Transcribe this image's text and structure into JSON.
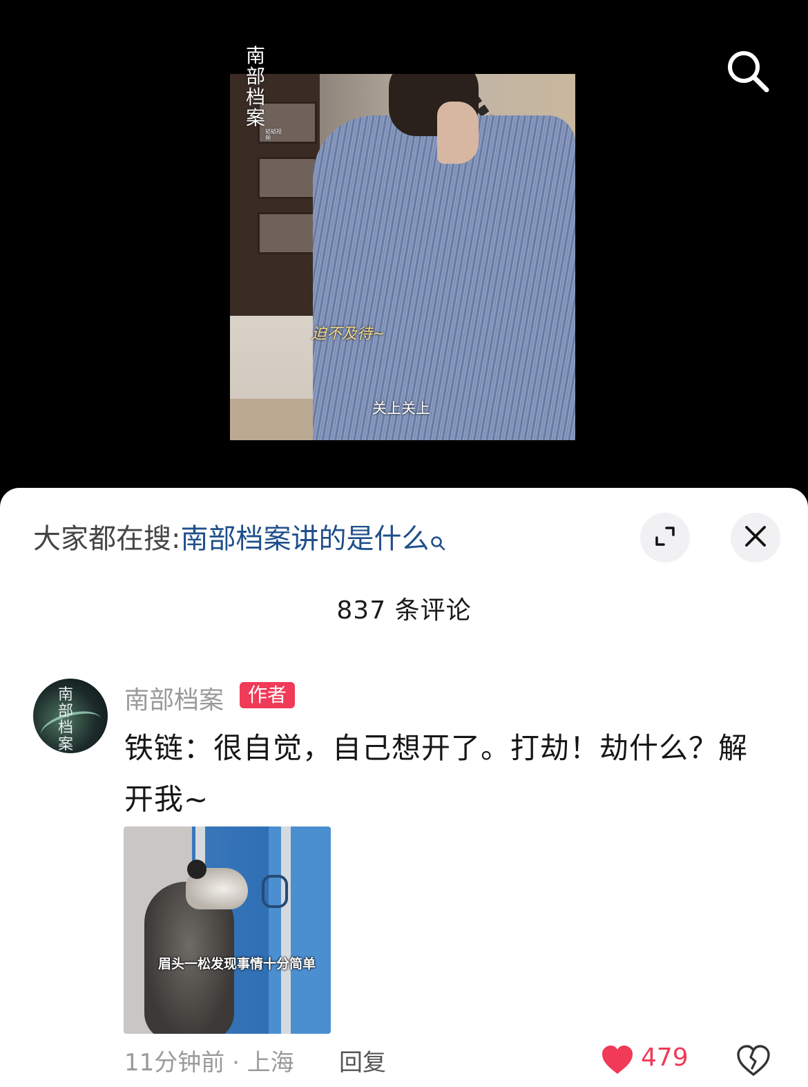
{
  "video": {
    "show_logo": "南部档案",
    "show_logo_small": "韬韬视频",
    "subtitle_top": "迫不及待~",
    "subtitle_bottom": "关上关上"
  },
  "top_bar": {
    "search_icon": "search-icon"
  },
  "comment_panel": {
    "hot_search_prefix": "大家都在搜:",
    "hot_search_query": "南部档案讲的是什么",
    "expand_icon": "expand-icon",
    "close_icon": "close-icon",
    "comment_count": "837 条评论"
  },
  "comment": {
    "author_name": "南部档案",
    "author_badge": "作者",
    "avatar_text": "南部档案",
    "text": "铁链：很自觉，自己想开了。打劫！劫什么？解开我~",
    "image_caption": "眉头一松发现事情十分简单",
    "time_location": "11分钟前 · 上海",
    "reply_label": "回复",
    "like_count": "479",
    "liked": true,
    "colors": {
      "accent": "#f03a57",
      "link": "#1f4f8a"
    }
  }
}
